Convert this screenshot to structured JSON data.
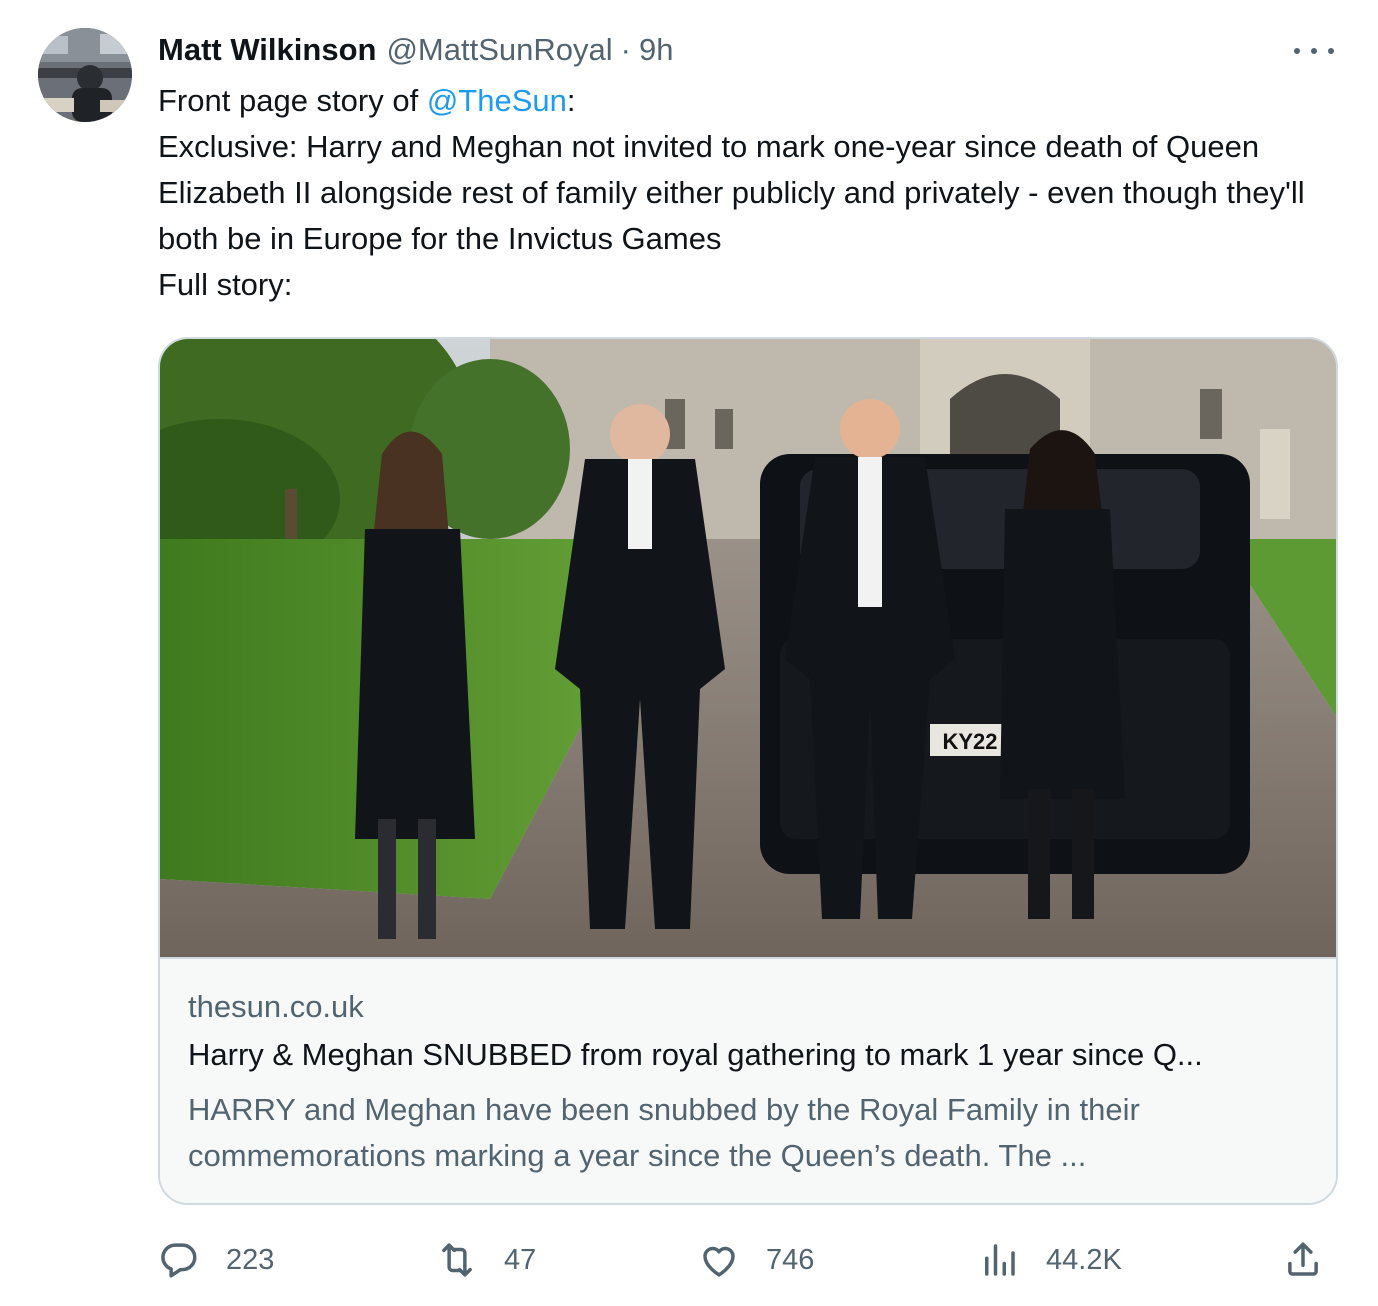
{
  "author": {
    "display_name": "Matt Wilkinson",
    "handle": "@MattSunRoyal",
    "separator": "·",
    "time": "9h"
  },
  "tweet": {
    "line1_prefix": "Front page story of ",
    "line1_mention": "@TheSun",
    "line1_suffix": ":",
    "line2": "Exclusive: Harry and Meghan not invited to mark one-year since death of Queen Elizabeth II alongside rest of family either publicly and privately - even though they'll both be in Europe for the Invictus Games",
    "line3": "Full story:"
  },
  "card": {
    "image_plate": "KY22",
    "domain": "thesun.co.uk",
    "title": "Harry & Meghan SNUBBED from royal gathering to mark 1 year since Q...",
    "description": "HARRY and Meghan have been snubbed by the Royal Family in their commemorations marking a year since the Queen’s death. The ..."
  },
  "actions": {
    "replies": "223",
    "reposts": "47",
    "likes": "746",
    "views": "44.2K"
  },
  "icons": {
    "reply": "reply-icon",
    "repost": "repost-icon",
    "like": "heart-icon",
    "views": "views-icon",
    "share": "share-icon",
    "more": "more-icon"
  },
  "colors": {
    "text": "#0f1419",
    "secondary": "#536471",
    "accent": "#1d9bf0",
    "border": "#cfd9de"
  }
}
